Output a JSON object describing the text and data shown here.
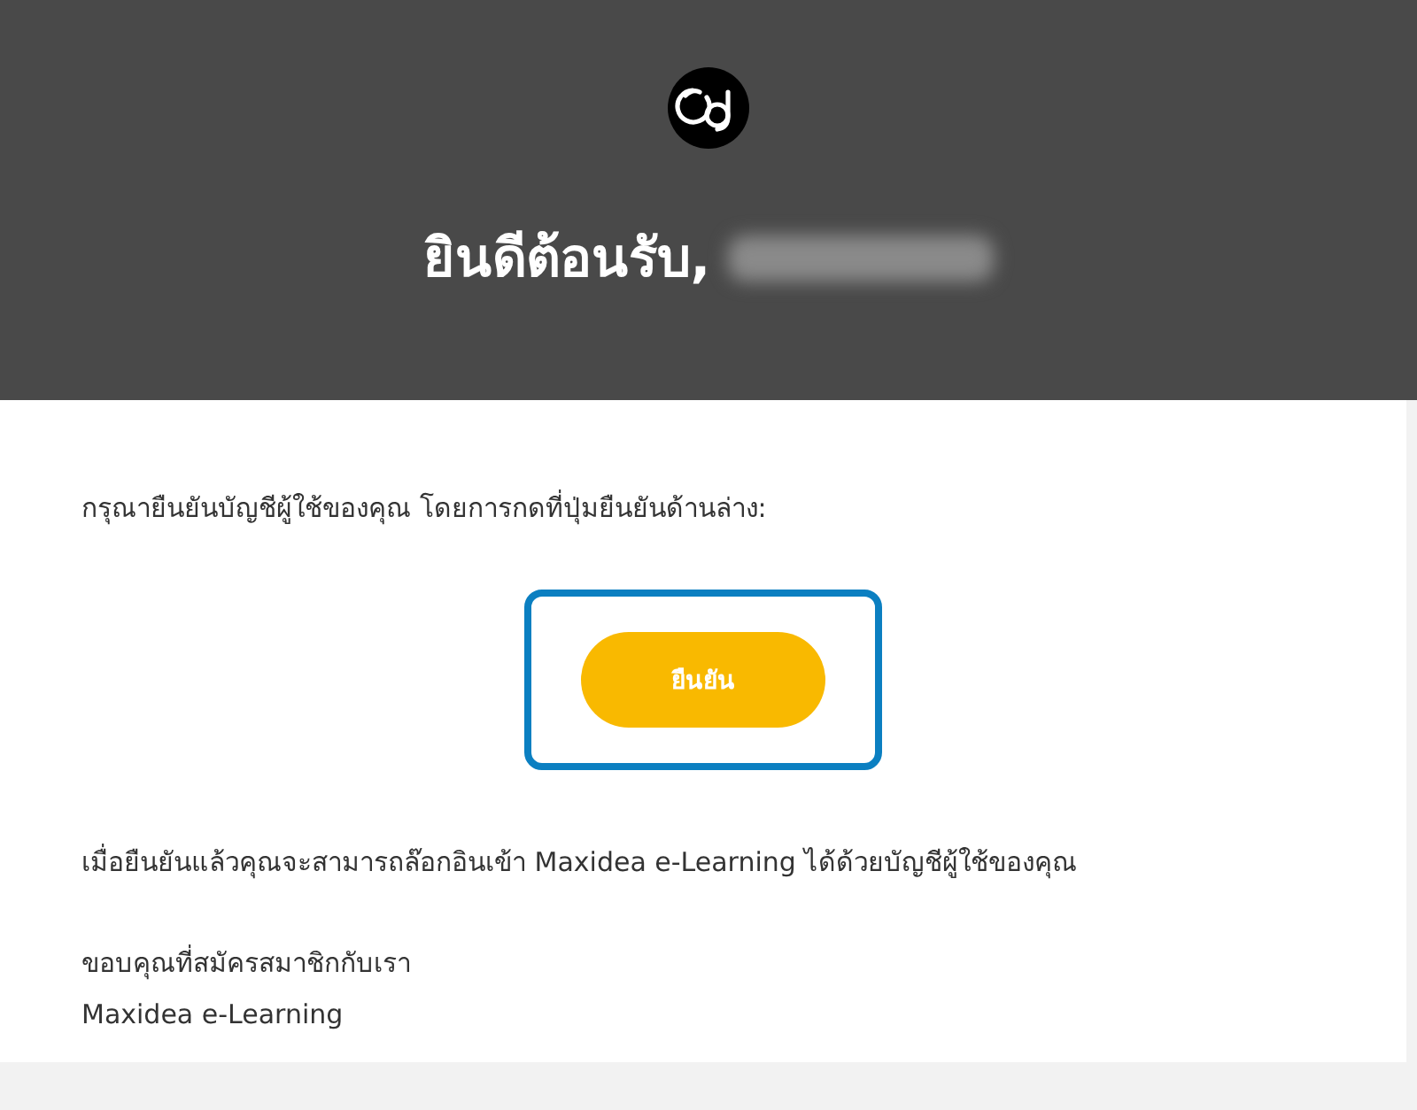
{
  "header": {
    "title": "ยินดีต้อนรับ,",
    "name_redacted": true
  },
  "body": {
    "instruction": "กรุณายืนยันบัญชีผู้ใช้ของคุณ โดยการกดที่ปุ่มยืนยันด้านล่าง:",
    "button": {
      "label": "ยืนยัน",
      "highlighted": true
    },
    "note": "เมื่อยืนยันแล้วคุณจะสามารถล๊อกอินเข้า Maxidea e-Learning ได้ด้วยบัญชีผู้ใช้ของคุณ",
    "closing": "ขอบคุณที่สมัครสมาชิกกับเรา",
    "signature": "Maxidea e-Learning"
  }
}
